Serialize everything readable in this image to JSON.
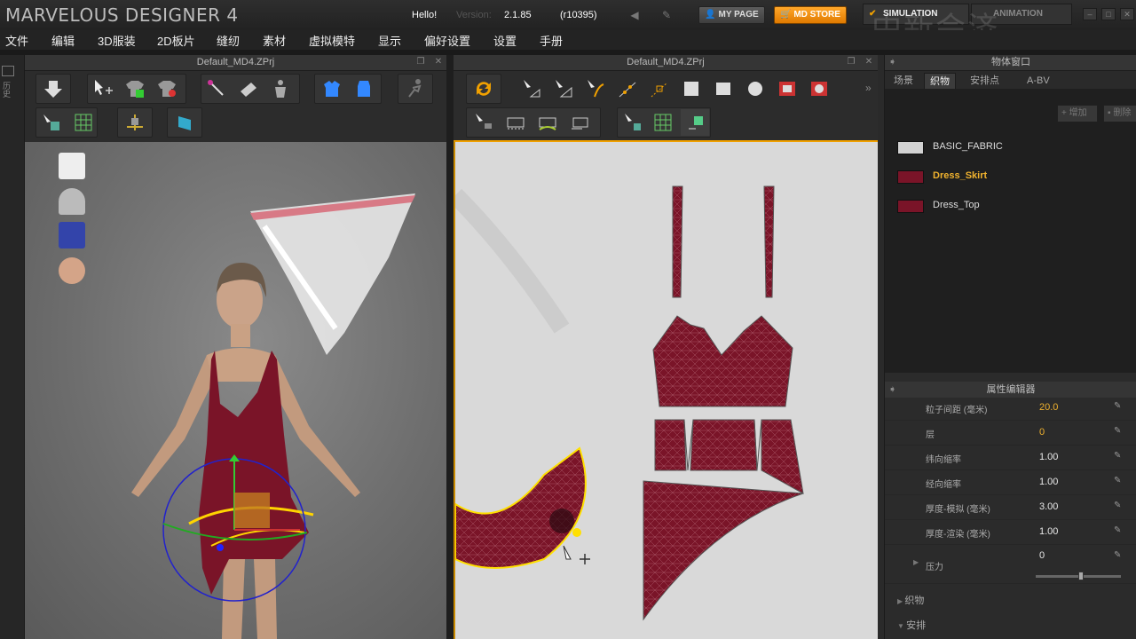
{
  "app": {
    "title": "MARVELOUS DESIGNER 4",
    "greeting": "Hello!",
    "version_label": "Version:",
    "version": "2.1.85",
    "revision": "(r10395)",
    "my_page": "MY PAGE",
    "md_store": "MD STORE",
    "mode_simulation": "SIMULATION",
    "mode_animation": "ANIMATION",
    "watermark": "中新会济"
  },
  "menu": [
    "文件",
    "编辑",
    "3D服装",
    "2D板片",
    "缝纫",
    "素材",
    "虚拟模特",
    "显示",
    "偏好设置",
    "设置",
    "手册"
  ],
  "left_strip_label": "历史",
  "panel3d": {
    "title": "Default_MD4.ZPrj"
  },
  "panel2d": {
    "title": "Default_MD4.ZPrj"
  },
  "object_window": {
    "title": "物体窗口",
    "tabs": [
      "场景",
      "织物",
      "安排点",
      "A-BV"
    ],
    "active_tab": "织物",
    "add_label": "增加",
    "delete_label": "删除",
    "fabrics": [
      {
        "name": "BASIC_FABRIC",
        "color": "#d2d2d2",
        "selected": false
      },
      {
        "name": "Dress_Skirt",
        "color": "#7a1428",
        "selected": true
      },
      {
        "name": "Dress_Top",
        "color": "#7a1428",
        "selected": false
      }
    ]
  },
  "property_editor": {
    "title": "属性编辑器",
    "rows": [
      {
        "label": "粒子间距 (毫米)",
        "value": "20.0",
        "highlight": true
      },
      {
        "label": "层",
        "value": "0",
        "highlight": true
      },
      {
        "label": "纬向缩率",
        "value": "1.00",
        "highlight": false
      },
      {
        "label": "经向缩率",
        "value": "1.00",
        "highlight": false
      },
      {
        "label": "厚度-模拟 (毫米)",
        "value": "3.00",
        "highlight": false
      },
      {
        "label": "厚度-渲染 (毫米)",
        "value": "1.00",
        "highlight": false
      }
    ],
    "pressure_label": "压力",
    "pressure_value": "0",
    "pressure_level": 0.5,
    "sections": [
      "织物",
      "安排"
    ]
  },
  "colors": {
    "accent": "#f0a000",
    "fabric": "#7a1428",
    "selected_text": "#f0b22e"
  }
}
